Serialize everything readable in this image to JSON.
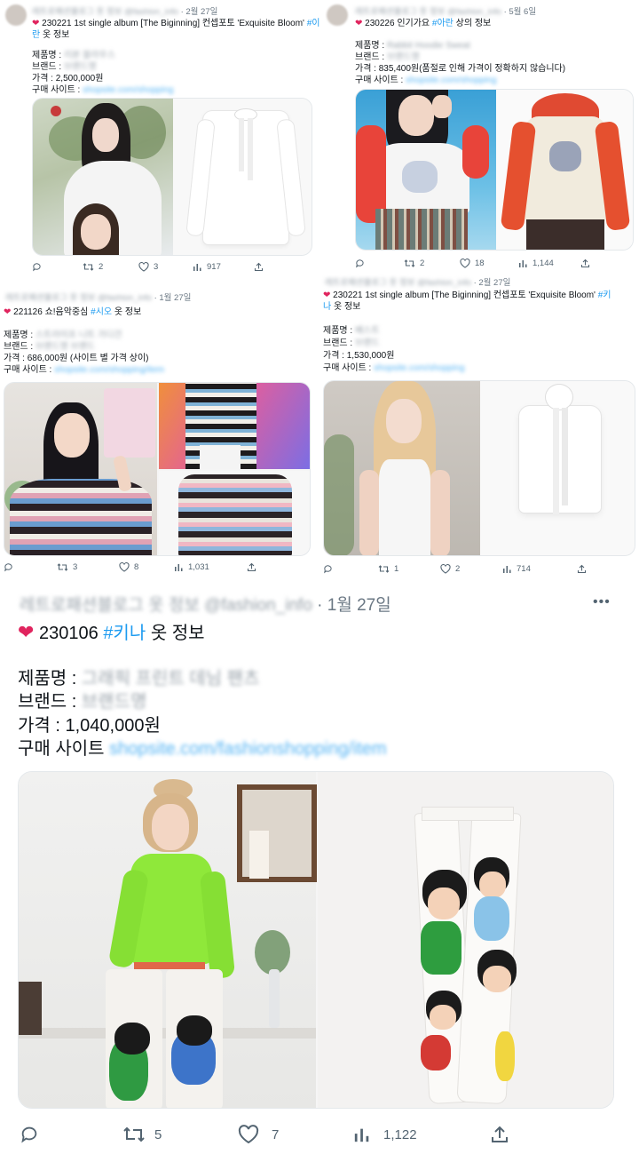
{
  "tweet1": {
    "name_blur": "레트로패션블로그 옷 정보",
    "handle_blur": "@fashion_info",
    "date": "· 2월 27일",
    "heart": "❤",
    "line1_pre": "230221 1st single album [The Biginning] 컨셉포토 'Exquisite Bloom'",
    "line1_tag": "#이",
    "line2_tag": "란",
    "line2_post": "옷 정보",
    "product_label": "제품명 :",
    "product_val": "리본 블라우스",
    "brand_label": "브랜드 :",
    "brand_val": "브랜드명",
    "price_label": "가격 :",
    "price_val": "2,500,000원",
    "site_label": "구매 사이트 :",
    "site_val": "shopsite.com/shopping",
    "reply": "",
    "retweet": "2",
    "like": "3",
    "views": "917"
  },
  "tweet2": {
    "name_blur": "레트로패션블로그 옷 정보",
    "handle_blur": "@fashion_info",
    "date": "· 5월 6일",
    "heart": "❤",
    "line1_pre": "230226 인기가요",
    "line1_tag": "#아란",
    "line1_post": "상의 정보",
    "product_label": "제품명 :",
    "product_val": "Rabbit Hoodie Sweat",
    "brand_label": "브랜드 :",
    "brand_val": "브랜드명",
    "price_label": "가격 :",
    "price_val": "835,400원(품절로 인해 가격이 정확하지 않습니다)",
    "site_label": "구매 사이트 :",
    "site_val": "shopsite.com/shopping",
    "reply": "",
    "retweet": "2",
    "like": "18",
    "views": "1,144"
  },
  "tweet3": {
    "name_blur": "레트로패션블로그 옷 정보",
    "handle_blur": "@fashion_info",
    "date": "· 1월 27일",
    "heart": "❤",
    "line1_pre": "221126 쇼!음악중심",
    "line1_tag": "#시오",
    "line1_post": "옷 정보",
    "product_label": "제품명 :",
    "product_val": "스트라이프 니트 가디건",
    "brand_label": "브랜드 :",
    "brand_val": "브랜드명 브랜드",
    "price_label": "가격 :",
    "price_val": "686,000원 (사이트 별 가격 상이)",
    "site_label": "구매 사이트 :",
    "site_val": "shopsite.com/shopping/item",
    "reply": "",
    "retweet": "3",
    "like": "8",
    "views": "1,031"
  },
  "tweet4": {
    "name_blur": "레트로패션블로그 옷 정보",
    "handle_blur": "@fashion_info",
    "date": "· 2월 27일",
    "heart": "❤",
    "line1_pre": "230221 1st single album [The Biginning] 컨셉포토 'Exquisite Bloom'",
    "line1_tag": "#키",
    "line2_tag": "나",
    "line2_post": "옷 정보",
    "product_label": "제품명 :",
    "product_val": "베스트",
    "brand_label": "브랜드 :",
    "brand_val": "브랜드",
    "price_label": "가격 :",
    "price_val": "1,530,000원",
    "site_label": "구매 사이트 :",
    "site_val": "shopsite.com/shopping",
    "reply": "",
    "retweet": "1",
    "like": "2",
    "views": "714"
  },
  "tweet5": {
    "name_blur": "레트로패션블로그 옷 정보",
    "handle_blur": "@fashion_info",
    "date": "· 1월 27일",
    "more": "•••",
    "heart": "❤",
    "line1_pre": "230106",
    "line1_tag": "#키나",
    "line1_post": "옷 정보",
    "product_label": "제품명 :",
    "product_val": "그래픽 프린트 데님 팬츠",
    "brand_label": "브랜드 :",
    "brand_val": "브랜드명",
    "price_label": "가격 :",
    "price_val": "1,040,000원",
    "site_label": "구매 사이트",
    "site_val": "shopsite.com/fashionshopping/item",
    "reply": "",
    "retweet": "5",
    "like": "7",
    "views": "1,122"
  },
  "colors": {
    "accent": "#1d9bf0",
    "heart": "#e0245e",
    "icon_gray": "#536471",
    "neon_green": "#8fe83a"
  },
  "icons": [
    "reply-icon",
    "retweet-icon",
    "like-icon",
    "views-icon",
    "share-icon",
    "heart-emoji-icon",
    "more-icon"
  ]
}
